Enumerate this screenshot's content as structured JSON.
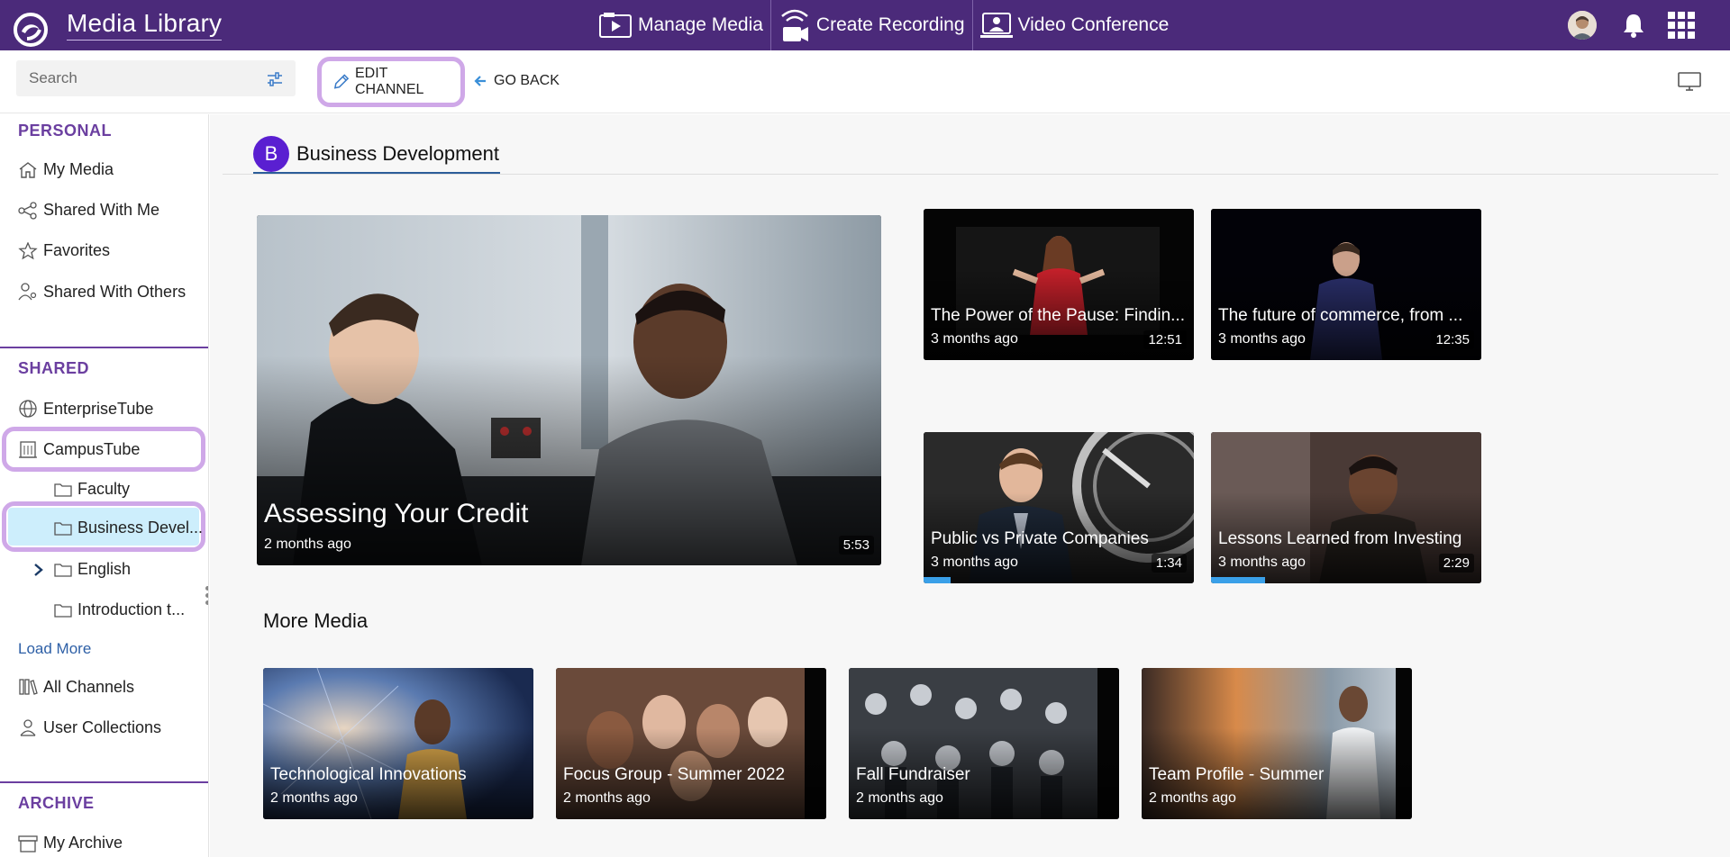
{
  "app": {
    "title": "Media Library",
    "nav": [
      {
        "label": "Manage Media",
        "icon": "manage-media-icon"
      },
      {
        "label": "Create Recording",
        "icon": "create-recording-icon"
      },
      {
        "label": "Video Conference",
        "icon": "video-conference-icon"
      }
    ]
  },
  "toolbar": {
    "search_placeholder": "Search",
    "edit_channel_label": "EDIT CHANNEL",
    "go_back_label": "GO BACK"
  },
  "sidebar": {
    "personal": {
      "title": "PERSONAL",
      "items": [
        "My Media",
        "Shared With Me",
        "Favorites",
        "Shared With Others"
      ]
    },
    "shared": {
      "title": "SHARED",
      "items": [
        "EnterpriseTube",
        "CampusTube",
        "Faculty",
        "Business Devel...",
        "English",
        "Introduction t..."
      ],
      "load_more": "Load More",
      "after": [
        "All Channels",
        "User Collections"
      ]
    },
    "archive": {
      "title": "ARCHIVE",
      "items": [
        "My Archive"
      ]
    }
  },
  "channel": {
    "badge": "B",
    "name": "Business Development"
  },
  "featured": {
    "title": "Assessing Your Credit",
    "age": "2 months ago",
    "duration": "5:53"
  },
  "grid": [
    {
      "title": "The Power of the Pause: Findin...",
      "age": "3 months ago",
      "duration": "12:51",
      "progress": 0
    },
    {
      "title": "The future of commerce, from ...",
      "age": "3 months ago",
      "duration": "12:35",
      "progress": 0
    },
    {
      "title": "Public vs Private Companies",
      "age": "3 months ago",
      "duration": "1:34",
      "progress": 0.1
    },
    {
      "title": "Lessons Learned from Investing",
      "age": "3 months ago",
      "duration": "2:29",
      "progress": 0.2
    }
  ],
  "more_media": {
    "title": "More Media",
    "items": [
      {
        "title": "Technological Innovations",
        "age": "2 months ago"
      },
      {
        "title": "Focus Group - Summer 2022",
        "age": "2 months ago"
      },
      {
        "title": "Fall Fundraiser",
        "age": "2 months ago"
      },
      {
        "title": "Team Profile - Summer",
        "age": "2 months ago"
      }
    ]
  },
  "colors": {
    "topbar": "#4b2a7a",
    "accent": "#6b3fa0",
    "highlight": "#cfa8e8",
    "selected": "#cdeefc",
    "progress": "#3aa0e8"
  }
}
